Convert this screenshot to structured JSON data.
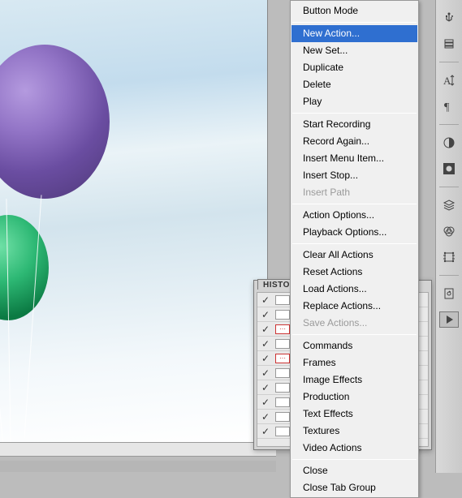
{
  "canvas": {
    "subject": "balloons-sky"
  },
  "history_panel": {
    "tab_label": "HISTO",
    "rows": [
      {
        "checked": true,
        "mod": false
      },
      {
        "checked": true,
        "mod": false
      },
      {
        "checked": true,
        "mod": true
      },
      {
        "checked": true,
        "mod": false
      },
      {
        "checked": true,
        "mod": true
      },
      {
        "checked": true,
        "mod": false
      },
      {
        "checked": true,
        "mod": false
      },
      {
        "checked": true,
        "mod": false
      },
      {
        "checked": true,
        "mod": false
      },
      {
        "checked": true,
        "mod": false
      }
    ]
  },
  "menu": {
    "groups": [
      [
        {
          "label": "Button Mode",
          "enabled": true,
          "selected": false
        }
      ],
      [
        {
          "label": "New Action...",
          "enabled": true,
          "selected": true
        },
        {
          "label": "New Set...",
          "enabled": true,
          "selected": false
        },
        {
          "label": "Duplicate",
          "enabled": true,
          "selected": false
        },
        {
          "label": "Delete",
          "enabled": true,
          "selected": false
        },
        {
          "label": "Play",
          "enabled": true,
          "selected": false
        }
      ],
      [
        {
          "label": "Start Recording",
          "enabled": true,
          "selected": false
        },
        {
          "label": "Record Again...",
          "enabled": true,
          "selected": false
        },
        {
          "label": "Insert Menu Item...",
          "enabled": true,
          "selected": false
        },
        {
          "label": "Insert Stop...",
          "enabled": true,
          "selected": false
        },
        {
          "label": "Insert Path",
          "enabled": false,
          "selected": false
        }
      ],
      [
        {
          "label": "Action Options...",
          "enabled": true,
          "selected": false
        },
        {
          "label": "Playback Options...",
          "enabled": true,
          "selected": false
        }
      ],
      [
        {
          "label": "Clear All Actions",
          "enabled": true,
          "selected": false
        },
        {
          "label": "Reset Actions",
          "enabled": true,
          "selected": false
        },
        {
          "label": "Load Actions...",
          "enabled": true,
          "selected": false
        },
        {
          "label": "Replace Actions...",
          "enabled": true,
          "selected": false
        },
        {
          "label": "Save Actions...",
          "enabled": false,
          "selected": false
        }
      ],
      [
        {
          "label": "Commands",
          "enabled": true,
          "selected": false
        },
        {
          "label": "Frames",
          "enabled": true,
          "selected": false
        },
        {
          "label": "Image Effects",
          "enabled": true,
          "selected": false
        },
        {
          "label": "Production",
          "enabled": true,
          "selected": false
        },
        {
          "label": "Text Effects",
          "enabled": true,
          "selected": false
        },
        {
          "label": "Textures",
          "enabled": true,
          "selected": false
        },
        {
          "label": "Video Actions",
          "enabled": true,
          "selected": false
        }
      ],
      [
        {
          "label": "Close",
          "enabled": true,
          "selected": false
        },
        {
          "label": "Close Tab Group",
          "enabled": true,
          "selected": false
        }
      ]
    ]
  },
  "right_tools": [
    {
      "name": "usb-icon"
    },
    {
      "name": "stack-icon"
    },
    {
      "name": "divider"
    },
    {
      "name": "char-height-icon"
    },
    {
      "name": "pilcrow-icon"
    },
    {
      "name": "divider"
    },
    {
      "name": "contrast-icon"
    },
    {
      "name": "camera-box-icon"
    },
    {
      "name": "divider"
    },
    {
      "name": "layers-icon"
    },
    {
      "name": "channels-icon"
    },
    {
      "name": "crop-icon"
    },
    {
      "name": "divider"
    },
    {
      "name": "history-icon"
    },
    {
      "name": "play-button-icon"
    }
  ]
}
